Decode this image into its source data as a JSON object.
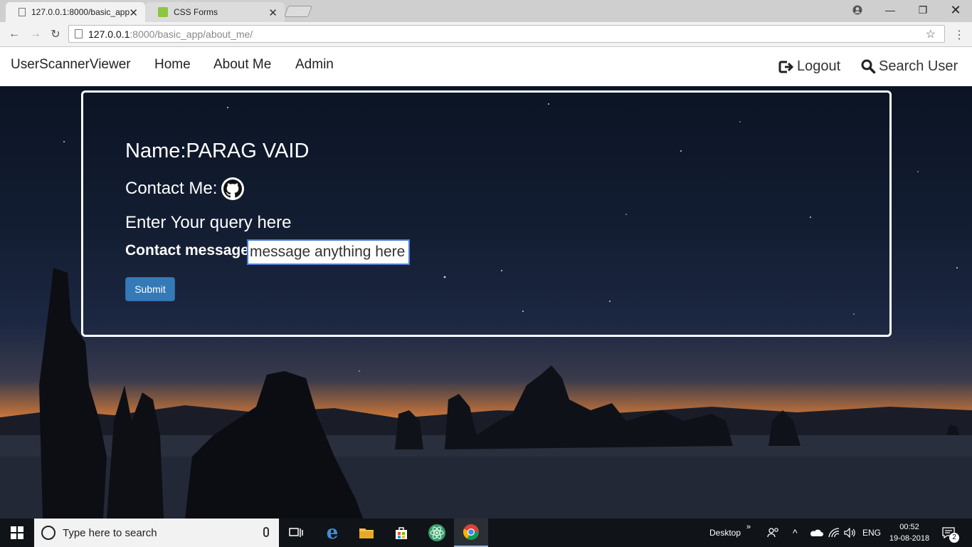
{
  "browser": {
    "tabs": [
      {
        "title": "127.0.0.1:8000/basic_app",
        "active": true
      },
      {
        "title": "CSS Forms",
        "active": false
      }
    ],
    "url_host": "127.0.0.1",
    "url_path": ":8000/basic_app/about_me/"
  },
  "navbar": {
    "brand": "UserScannerViewer",
    "links": [
      "Home",
      "About Me",
      "Admin"
    ],
    "logout": "Logout",
    "search_user": "Search User"
  },
  "profile": {
    "name_line": "Name:PARAG VAID",
    "contact_label": "Contact Me:",
    "query_heading": "Enter Your query here",
    "message_label": "Contact message:",
    "message_value": "message anything here",
    "submit_label": "Submit"
  },
  "taskbar": {
    "search_placeholder": "Type here to search",
    "desktop_label": "Desktop",
    "language": "ENG",
    "time": "00:52",
    "date": "19-08-2018",
    "notification_count": "2"
  },
  "colors": {
    "accent": "#337ab7",
    "input_focus": "#4a7fd4"
  }
}
